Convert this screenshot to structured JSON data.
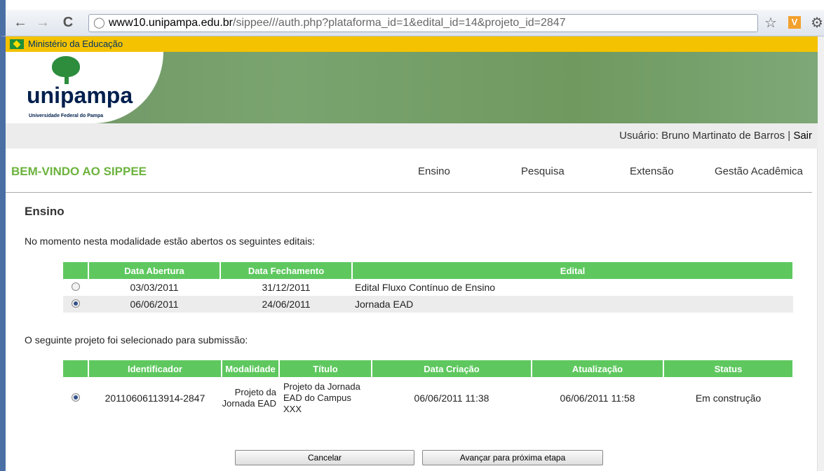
{
  "browser": {
    "url_host": "www10.unipampa.edu.br",
    "url_rest": "/sippee///auth.php?plataforma_id=1&edital_id=14&projeto_id=2847"
  },
  "gov_bar": {
    "text": "Ministério da Educação"
  },
  "logo": {
    "name": "unipampa",
    "subtitle": "Universidade Federal do Pampa"
  },
  "user_bar": {
    "label": "Usuário: Bruno Martinato de Barros |",
    "logout": "Sair"
  },
  "header": {
    "welcome": "BEM-VINDO AO SIPPEE",
    "menu": [
      "Ensino",
      "Pesquisa",
      "Extensão",
      "Gestão Acadêmica"
    ]
  },
  "main": {
    "title": "Ensino",
    "open_editais_text": "No momento nesta modalidade estão abertos os seguintes editais:",
    "editais_headers": [
      "Data Abertura",
      "Data Fechamento",
      "Edital"
    ],
    "editais_rows": [
      {
        "selected": false,
        "abertura": "03/03/2011",
        "fechamento": "31/12/2011",
        "edital": "Edital Fluxo Contínuo de Ensino"
      },
      {
        "selected": true,
        "abertura": "06/06/2011",
        "fechamento": "24/06/2011",
        "edital": "Jornada EAD"
      }
    ],
    "project_text": "O seguinte projeto foi selecionado para submissão:",
    "projeto_headers": [
      "Identificador",
      "Modalidade",
      "Título",
      "Data Criação",
      "Atualização",
      "Status"
    ],
    "projeto_row": {
      "selected": true,
      "identificador": "20110606113914-2847",
      "modalidade": "Projeto da Jornada EAD",
      "titulo": "Projeto da Jornada EAD do Campus XXX",
      "criacao": "06/06/2011 11:38",
      "atualizacao": "06/06/2011 11:58",
      "status": "Em construção"
    }
  },
  "buttons": {
    "cancel": "Cancelar",
    "next": "Avançar para próxima etapa"
  }
}
